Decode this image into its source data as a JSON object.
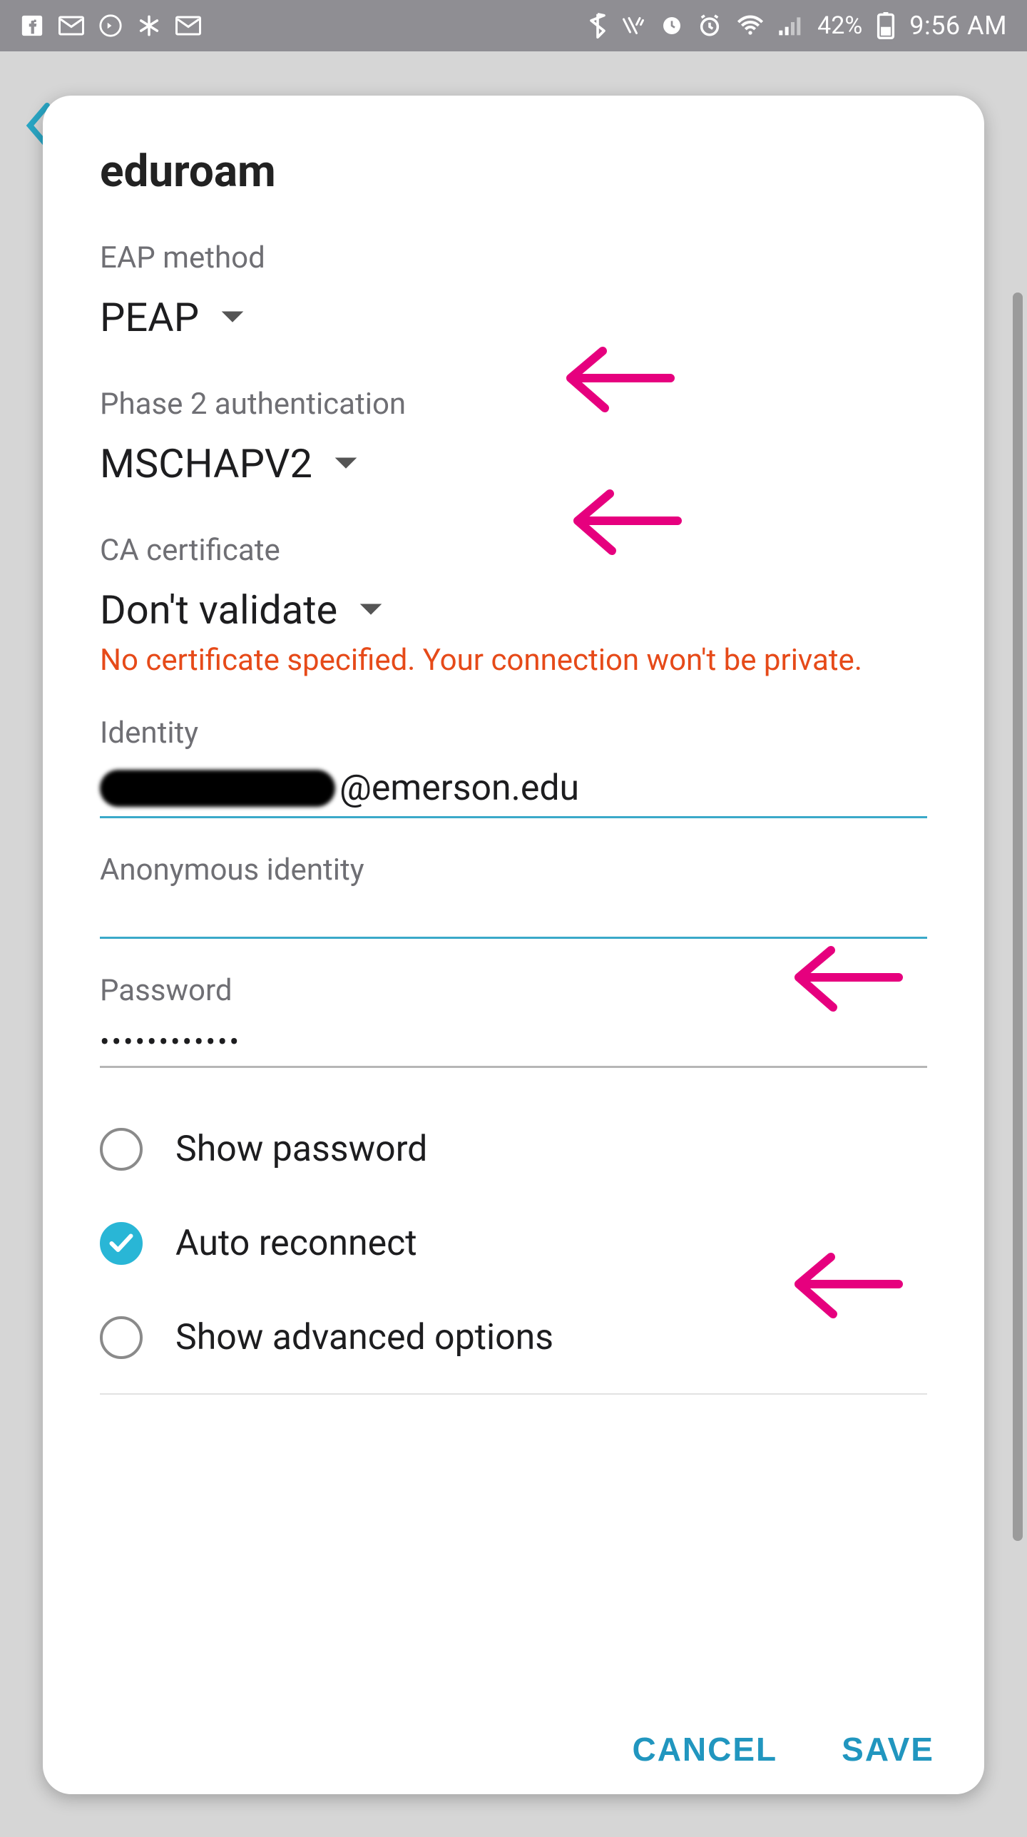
{
  "statusbar": {
    "battery_text": "42%",
    "time": "9:56 AM"
  },
  "dialog": {
    "title": "eduroam",
    "eap_label": "EAP method",
    "eap_value": "PEAP",
    "phase2_label": "Phase 2 authentication",
    "phase2_value": "MSCHAPV2",
    "ca_label": "CA certificate",
    "ca_value": "Don't validate",
    "warning": "No certificate specified. Your connection won't be private.",
    "identity_label": "Identity",
    "identity_suffix": "@emerson.edu",
    "anon_label": "Anonymous identity",
    "anon_value": "",
    "password_label": "Password",
    "password_masked": "••••••••••••",
    "show_password": "Show password",
    "auto_reconnect": "Auto reconnect",
    "show_advanced": "Show advanced options",
    "cancel": "CANCEL",
    "save": "SAVE"
  }
}
